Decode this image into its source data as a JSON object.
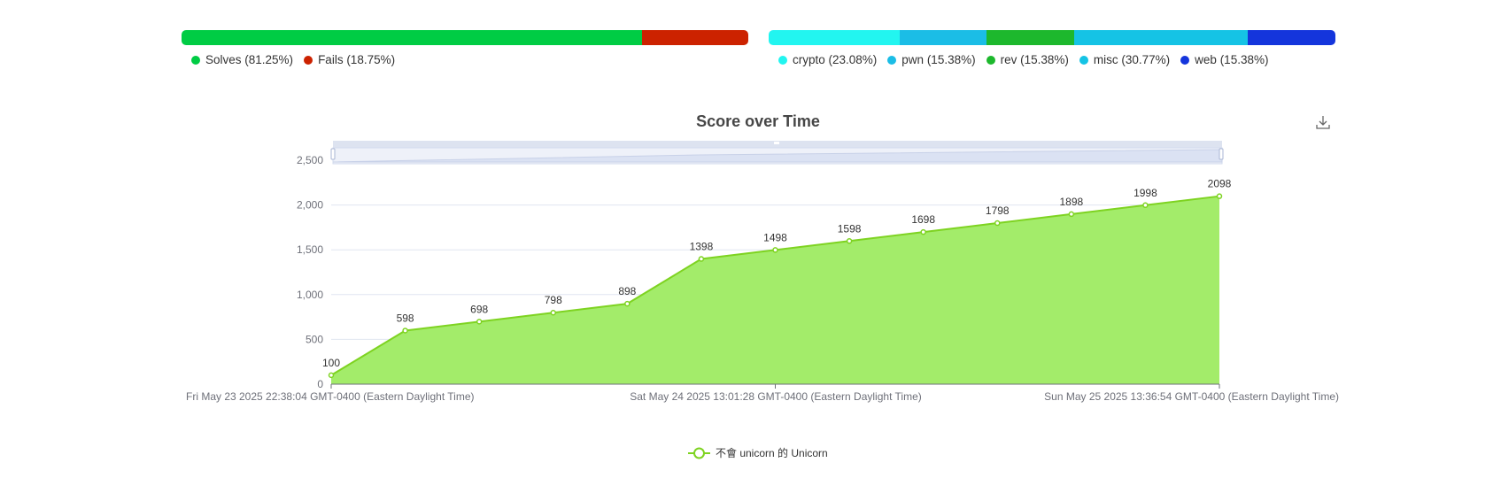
{
  "solve_bar": {
    "segments": [
      {
        "label": "Solves (81.25%)",
        "percent": 81.25,
        "color": "#00cc44"
      },
      {
        "label": "Fails (18.75%)",
        "percent": 18.75,
        "color": "#cc2200"
      }
    ]
  },
  "category_bar": {
    "segments": [
      {
        "label": "crypto (23.08%)",
        "percent": 23.08,
        "color": "#22f5f0"
      },
      {
        "label": "pwn (15.38%)",
        "percent": 15.38,
        "color": "#1bbde6"
      },
      {
        "label": "rev (15.38%)",
        "percent": 15.38,
        "color": "#1db82d"
      },
      {
        "label": "misc (30.77%)",
        "percent": 30.77,
        "color": "#15c3e5"
      },
      {
        "label": "web (15.38%)",
        "percent": 15.38,
        "color": "#1435dc"
      }
    ]
  },
  "chart_data": {
    "type": "area",
    "title": "Score over Time",
    "xlabel": "",
    "ylabel": "",
    "x_ticks": [
      "Fri May 23 2025 22:38:04 GMT-0400 (Eastern Daylight Time)",
      "Sat May 24 2025 13:01:28 GMT-0400 (Eastern Daylight Time)",
      "Sun May 25 2025 13:36:54 GMT-0400 (Eastern Daylight Time)"
    ],
    "y_ticks": [
      "0",
      "500",
      "1,000",
      "1,500",
      "2,000",
      "2,500"
    ],
    "ylim": [
      0,
      2500
    ],
    "grid": true,
    "legend_position": "bottom",
    "data_zoom": true,
    "series": [
      {
        "name": "不會 unicorn 的 Unicorn",
        "color": "#7ed321",
        "fill": "#a3ec6a",
        "values": [
          100,
          598,
          698,
          798,
          898,
          1398,
          1498,
          1598,
          1698,
          1798,
          1898,
          1998,
          2098
        ]
      }
    ]
  },
  "toolbar": {
    "download_icon": "download-icon"
  }
}
